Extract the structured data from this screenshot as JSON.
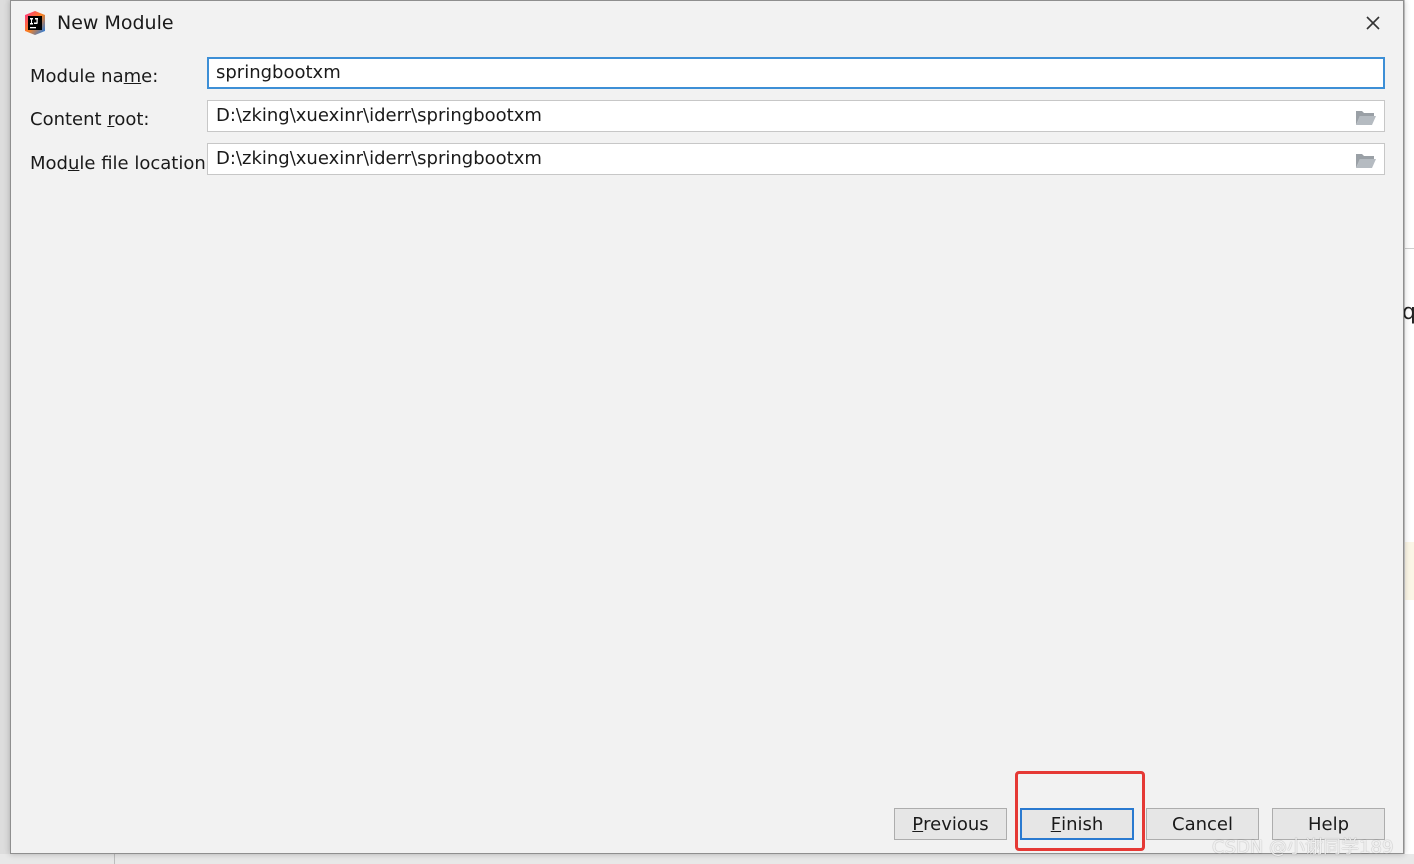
{
  "dialog": {
    "title": "New Module",
    "close_symbol": "✕"
  },
  "form": {
    "module_name": {
      "label_pre": "Module na",
      "label_mnemonic": "m",
      "label_post": "e:",
      "value": "springbootxm"
    },
    "content_root": {
      "label_pre": "Content ",
      "label_mnemonic": "r",
      "label_post": "oot:",
      "value": "D:\\zking\\xuexinr\\iderr\\springbootxm"
    },
    "module_file_location": {
      "label_pre": "Mod",
      "label_mnemonic": "u",
      "label_post": "le file location:",
      "value": "D:\\zking\\xuexinr\\iderr\\springbootxm"
    }
  },
  "buttons": {
    "previous": {
      "mnemonic": "P",
      "rest": "revious"
    },
    "finish": {
      "mnemonic": "F",
      "rest": "inish"
    },
    "cancel": {
      "label": "Cancel"
    },
    "help": {
      "label": "Help"
    }
  },
  "background": {
    "partial_char": "q"
  },
  "watermark": "CSDN @小谢同学189",
  "icons": {
    "app": "intellij-idea-icon",
    "close": "close-icon",
    "folder": "folder-open-icon"
  },
  "colors": {
    "focus": "#3d8fd6",
    "highlight": "#e53935",
    "dialog_bg": "#f2f2f2"
  }
}
